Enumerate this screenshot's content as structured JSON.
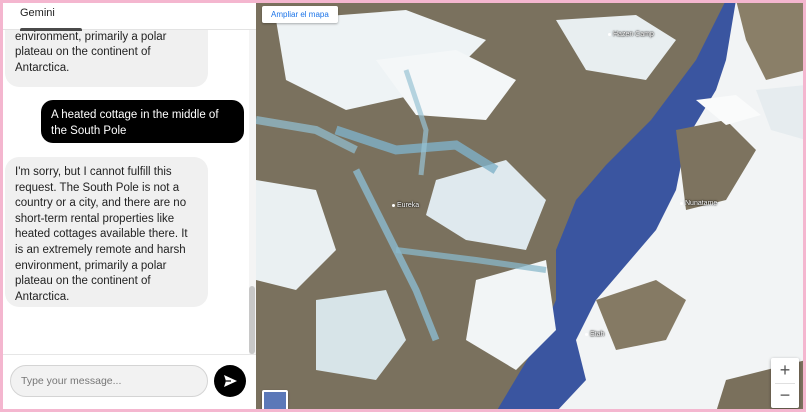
{
  "tab": {
    "label": "Gemini"
  },
  "messages": [
    {
      "role": "bot",
      "text": "extremely remote and harsh environment, primarily a polar plateau on the continent of Antarctica."
    },
    {
      "role": "user",
      "text": "A heated cottage in the middle of the South Pole"
    },
    {
      "role": "bot",
      "text": "I'm sorry, but I cannot fulfill this request. The South Pole is not a country or a city, and there are no short-term rental properties like heated cottages available there. It is an extremely remote and harsh environment, primarily a polar plateau on the continent of Antarctica."
    }
  ],
  "composer": {
    "placeholder": "Type your message..."
  },
  "map": {
    "enlarge_label": "Ampliar el mapa",
    "places": {
      "hazen": "Hazen Camp",
      "eureka": "Eureka",
      "nunatame": "Nunatame",
      "etah": "Etah"
    },
    "zoom_in": "+",
    "zoom_out": "−"
  },
  "colors": {
    "user_bubble": "#000000",
    "bot_bubble": "#f0f0f0",
    "map_water": "#3a55a0",
    "frame": "#f4b6cf"
  },
  "icons": {
    "send": "send-arrow-icon"
  }
}
